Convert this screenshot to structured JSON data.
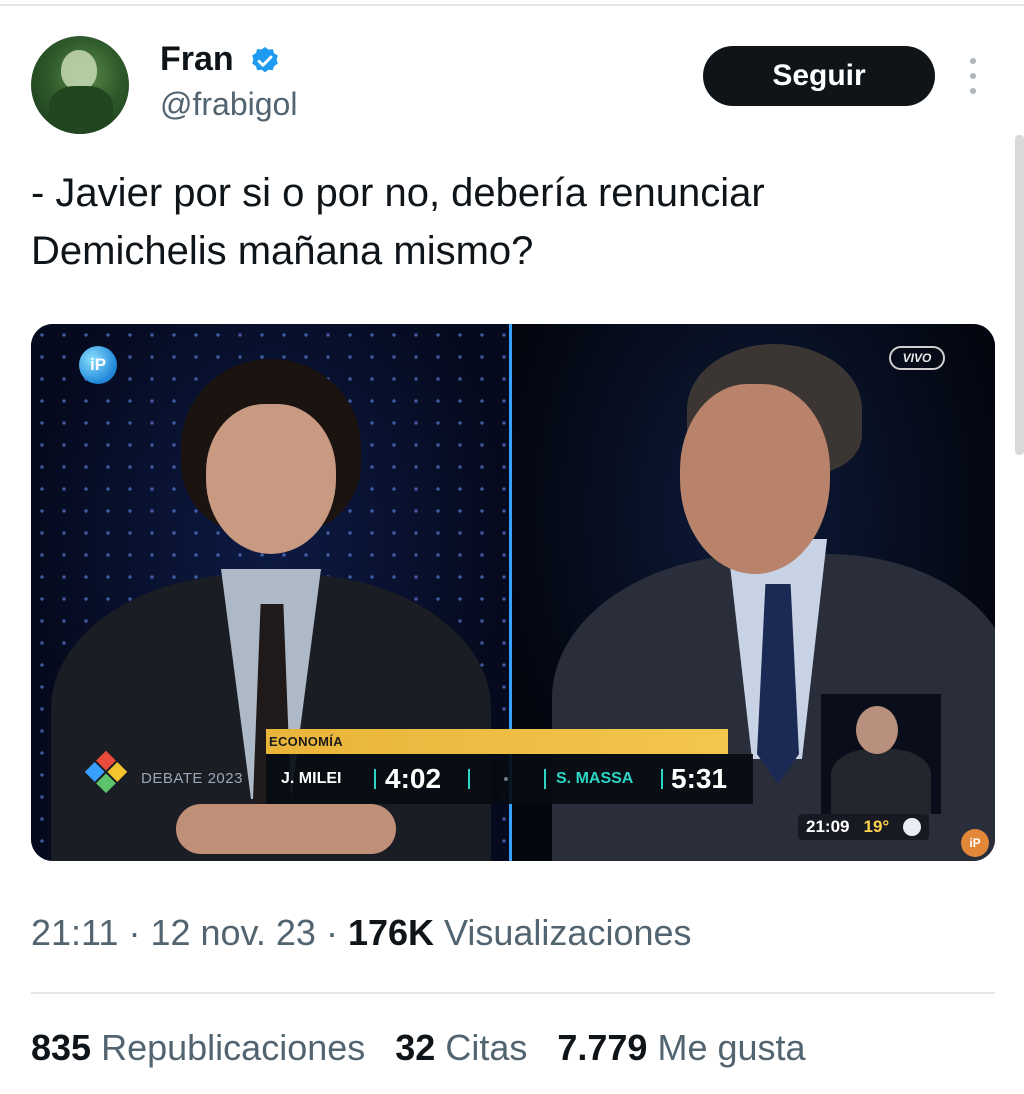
{
  "user": {
    "name": "Fran",
    "handle": "@frabigol",
    "verified_color": "#1d9bf0"
  },
  "follow_button": {
    "label": "Seguir"
  },
  "tweet": {
    "text_line1": "- Javier por si o por no, debería renunciar",
    "text_line2": "Demichelis mañana mismo?"
  },
  "media": {
    "channel_logo": "iP",
    "live_badge": "VIVO",
    "program_label": "DEBATE 2023",
    "topic": "ECONOMÍA",
    "candidate_left": {
      "name": "J. MILEI",
      "time": "4:02"
    },
    "candidate_right": {
      "name": "S. MASSA",
      "time": "5:31"
    },
    "clock": "21:09",
    "temperature": "19°",
    "channel_logo_small": "iP",
    "accent_color": "#2dd6c4"
  },
  "meta": {
    "time": "21:11",
    "separator1": "·",
    "date": "12 nov. 23",
    "separator2": "·",
    "views_count": "176K",
    "views_label": "Visualizaciones"
  },
  "stats": {
    "reposts_count": "835",
    "reposts_label": "Republicaciones",
    "quotes_count": "32",
    "quotes_label": "Citas",
    "likes_count": "7.779",
    "likes_label": "Me gusta"
  }
}
